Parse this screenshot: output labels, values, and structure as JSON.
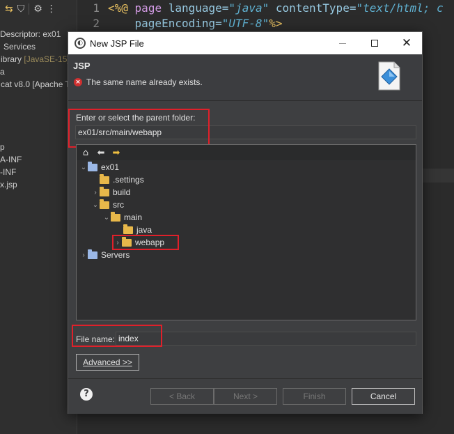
{
  "ide": {
    "left_tree": [
      {
        "text": "Descriptor: ex01"
      },
      {
        "text": "Services"
      },
      {
        "text": "ibrary",
        "extra": "[JavaSE-15]"
      },
      {
        "text": "a"
      },
      {
        "text": "cat v8.0 [Apache T"
      },
      {
        "text": "p"
      },
      {
        "text": "A-INF"
      },
      {
        "text": "-INF"
      },
      {
        "text": "x.jsp"
      }
    ],
    "line_numbers": [
      "1",
      "2"
    ],
    "code": {
      "line1": {
        "open": "<%@",
        "kw": "page",
        "attr1": "language=",
        "val1": "\"java\"",
        "attr2": "contentType=",
        "val2": "\"text/html; c"
      },
      "line2": {
        "attr": "pageEncoding=",
        "val": "\"UTF-8\"",
        "close": "%>"
      }
    }
  },
  "dialog": {
    "title": "New JSP File",
    "banner_title": "JSP",
    "error_message": "The same name already exists.",
    "parent_folder_label": "Enter or select the parent folder:",
    "parent_folder_value": "ex01/src/main/webapp",
    "tree": [
      {
        "label": "ex01",
        "chevron": "⌄"
      },
      {
        "label": ".settings",
        "chevron": ""
      },
      {
        "label": "build",
        "chevron": "›"
      },
      {
        "label": "src",
        "chevron": "⌄"
      },
      {
        "label": "main",
        "chevron": "⌄"
      },
      {
        "label": "java",
        "chevron": ""
      },
      {
        "label": "webapp",
        "chevron": "›"
      },
      {
        "label": "Servers",
        "chevron": "›"
      }
    ],
    "file_name_label": "File name:",
    "file_name_value": "index",
    "advanced_label": "Advanced >>",
    "buttons": {
      "back": "< Back",
      "next": "Next >",
      "finish": "Finish",
      "cancel": "Cancel"
    }
  },
  "colors": {
    "highlight_box": "#e0202a",
    "error": "#d03030",
    "folder": "#e8b84a"
  }
}
